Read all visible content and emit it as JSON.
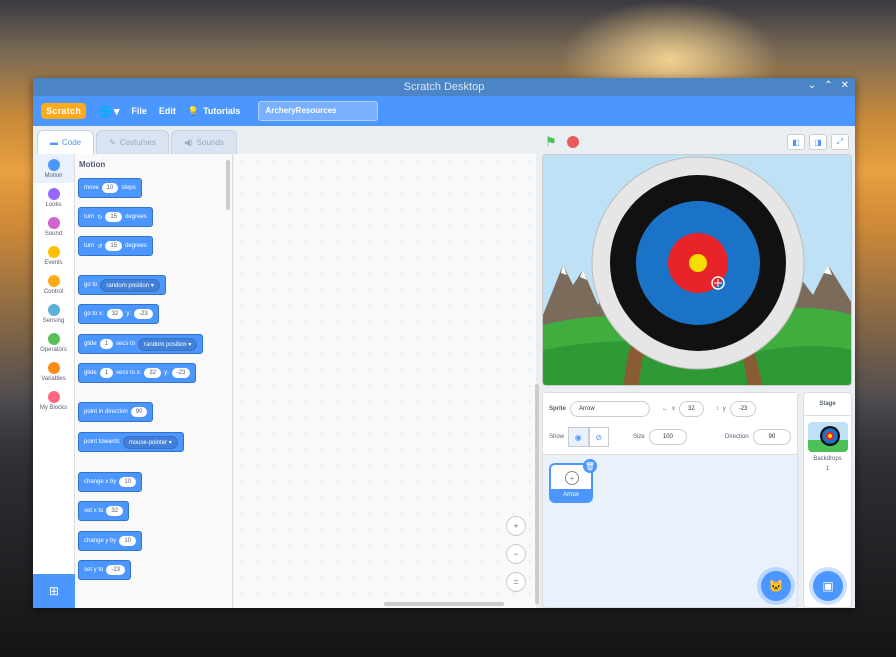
{
  "window": {
    "title": "Scratch Desktop"
  },
  "menubar": {
    "logo": "Scratch",
    "file": "File",
    "edit": "Edit",
    "tutorials": "Tutorials",
    "project_name": "ArcheryResources"
  },
  "tabs": [
    {
      "label": "Code",
      "active": true
    },
    {
      "label": "Costumes",
      "active": false
    },
    {
      "label": "Sounds",
      "active": false
    }
  ],
  "categories": [
    {
      "label": "Motion",
      "color": "#4c97ff"
    },
    {
      "label": "Looks",
      "color": "#9966ff"
    },
    {
      "label": "Sound",
      "color": "#cf63cf"
    },
    {
      "label": "Events",
      "color": "#ffbf00"
    },
    {
      "label": "Control",
      "color": "#ffab19"
    },
    {
      "label": "Sensing",
      "color": "#5cb1d6"
    },
    {
      "label": "Operators",
      "color": "#59c059"
    },
    {
      "label": "Variables",
      "color": "#ff8c1a"
    },
    {
      "label": "My Blocks",
      "color": "#ff6680"
    }
  ],
  "palette": {
    "title": "Motion",
    "blocks": {
      "move": {
        "a": "move",
        "v": "10",
        "b": "steps"
      },
      "turn_cw": {
        "a": "turn",
        "v": "15",
        "b": "degrees"
      },
      "turn_ccw": {
        "a": "turn",
        "v": "15",
        "b": "degrees"
      },
      "goto": {
        "a": "go to",
        "d": "random position"
      },
      "gotoxy": {
        "a": "go to x:",
        "x": "32",
        "ya": "y:",
        "y": "-23"
      },
      "glide_to": {
        "a": "glide",
        "v": "1",
        "b": "secs to",
        "d": "random position"
      },
      "glide_xy": {
        "a": "glide",
        "v": "1",
        "b": "secs to x:",
        "x": "32",
        "ya": "y:",
        "y": "-23"
      },
      "point_dir": {
        "a": "point in direction",
        "v": "90"
      },
      "point_towards": {
        "a": "point towards",
        "d": "mouse-pointer"
      },
      "change_x": {
        "a": "change x by",
        "v": "10"
      },
      "set_x": {
        "a": "set x to",
        "v": "32"
      },
      "change_y": {
        "a": "change y by",
        "v": "10"
      },
      "set_y": {
        "a": "set y to",
        "v": "-23"
      }
    }
  },
  "zoom": {
    "in": "+",
    "out": "−",
    "reset": "="
  },
  "sprite": {
    "label": "Sprite",
    "name": "Arrow",
    "x_label": "x",
    "x": "32",
    "y_label": "y",
    "y": "-23",
    "show_label": "Show",
    "size_label": "Size",
    "size": "100",
    "direction_label": "Direction",
    "direction": "90",
    "thumb_name": "Arrow"
  },
  "stage_pane": {
    "title": "Stage",
    "backdrops_label": "Backdrops",
    "backdrops_count": "1"
  }
}
